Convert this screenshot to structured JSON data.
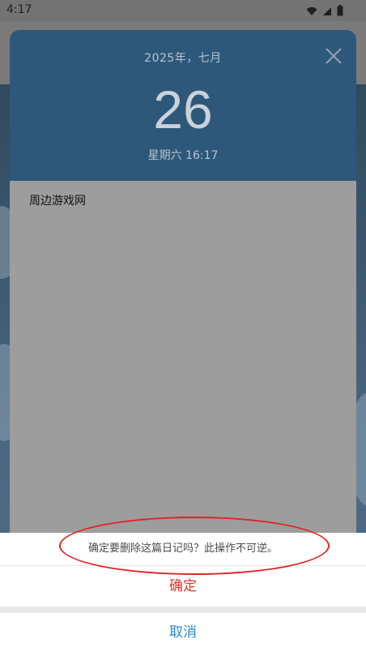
{
  "status_bar": {
    "time": "4:17",
    "icons": [
      "wifi-icon",
      "signal-icon",
      "battery-icon"
    ]
  },
  "diary": {
    "year_month": "2025年，七月",
    "day": "26",
    "weekday_time": "星期六 16:17",
    "content": "周边游戏网"
  },
  "dialog": {
    "message": "确定要删除这篇日记吗？此操作不可逆。",
    "confirm_label": "确定",
    "cancel_label": "取消"
  },
  "colors": {
    "header_blue": "#2e587a",
    "confirm_red": "#e8332a",
    "cancel_blue": "#2a86d6",
    "annotation_red": "#e02424"
  }
}
